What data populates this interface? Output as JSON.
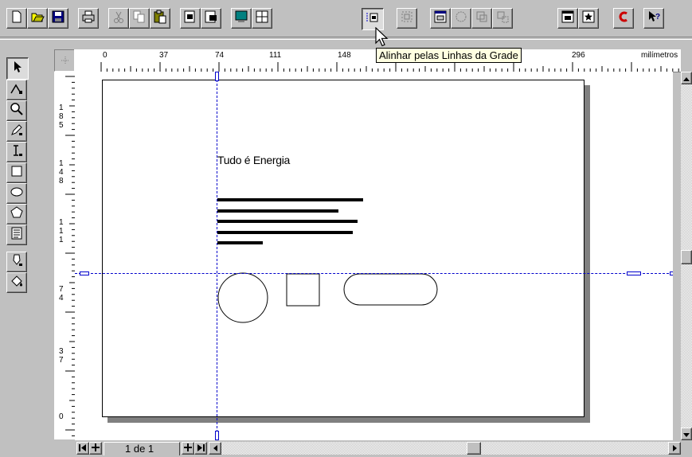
{
  "toolbar": {
    "buttons": [
      {
        "name": "new-icon"
      },
      {
        "name": "open-icon"
      },
      {
        "name": "save-icon"
      },
      {
        "name": "print-icon"
      },
      {
        "name": "cut-icon"
      },
      {
        "name": "copy-icon"
      },
      {
        "name": "paste-icon"
      },
      {
        "name": "import-icon"
      },
      {
        "name": "export-icon"
      },
      {
        "name": "monitor-icon"
      },
      {
        "name": "guides-icon"
      },
      {
        "name": "snap-to-grid-icon"
      },
      {
        "name": "snap-to-object-icon"
      },
      {
        "name": "object-properties-icon"
      },
      {
        "name": "circle-icon"
      },
      {
        "name": "group-icon"
      },
      {
        "name": "ungroup-icon"
      },
      {
        "name": "window-icon"
      },
      {
        "name": "star-icon"
      },
      {
        "name": "logo-c-icon"
      },
      {
        "name": "help-pointer-icon"
      }
    ]
  },
  "tooltip": {
    "text": "Alinhar pelas Linhas da Grade"
  },
  "ruler": {
    "h_labels": [
      "0",
      "37",
      "74",
      "111",
      "148",
      "296",
      "milímetros"
    ],
    "v_labels": [
      [
        "1",
        "8",
        "5"
      ],
      [
        "1",
        "4",
        "8"
      ],
      [
        "1",
        "1",
        "1"
      ],
      [
        "7",
        "4"
      ],
      [
        "3",
        "7"
      ],
      [
        "0"
      ]
    ]
  },
  "page": {
    "heading": "Tudo é Energia"
  },
  "status": {
    "page_indicator": "1 de 1"
  },
  "colors": {
    "face": "#c0c0c0",
    "guide": "#0000cc",
    "tooltip": "#ffffe1"
  }
}
